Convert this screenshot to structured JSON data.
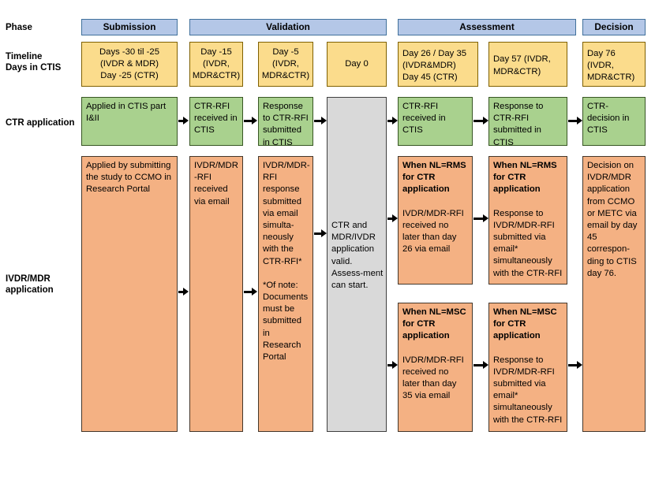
{
  "row_labels": {
    "phase": "Phase",
    "timeline": "Timeline\nDays in CTIS",
    "ctr": "CTR application",
    "ivdr": "IVDR/MDR\napplication"
  },
  "colors": {
    "phase_fill": "#b4c7e7",
    "phase_border": "#41719c",
    "timeline_fill": "#fbdc8c",
    "timeline_border": "#7f6000",
    "ctr_fill": "#a9d18e",
    "ctr_border": "#375623",
    "ivdr_fill": "#f4b183",
    "ivdr_border": "#44372b",
    "neutral_fill": "#d9d9d9",
    "neutral_border": "#3f3f3f",
    "arrow": "#000000",
    "background": "#ffffff"
  },
  "phases": [
    {
      "label": "Submission"
    },
    {
      "label": "Validation"
    },
    {
      "label": "Assessment"
    },
    {
      "label": "Decision"
    }
  ],
  "timeline": [
    {
      "lines": [
        "Days -30 til -25",
        "(IVDR & MDR)",
        "Day -25 (CTR)"
      ]
    },
    {
      "lines": [
        "Day -15",
        "(IVDR,",
        "MDR&CTR)"
      ]
    },
    {
      "lines": [
        "Day -5",
        "(IVDR,",
        "MDR&CTR)"
      ]
    },
    {
      "lines": [
        "Day 0"
      ]
    },
    {
      "lines": [
        "Day 26 / Day 35",
        "(IVDR&MDR)",
        "Day 45 (CTR)"
      ]
    },
    {
      "lines": [
        "Day 57 (IVDR,",
        "MDR&CTR)"
      ]
    },
    {
      "lines": [
        "Day 76",
        "(IVDR,",
        "MDR&CTR)"
      ]
    }
  ],
  "ctr_application": [
    {
      "text": "Applied in CTIS part I&II"
    },
    {
      "text": "CTR-RFI received in CTIS"
    },
    {
      "text": "Response to CTR-RFI submitted in CTIS"
    },
    {
      "text": ""
    },
    {
      "text": "CTR-RFI received in CTIS"
    },
    {
      "text": "Response to CTR-RFI submitted in CTIS"
    },
    {
      "text": "CTR-decision in CTIS"
    }
  ],
  "ivdr_application": {
    "submission": {
      "text": "Applied by submitting the study to CCMO in Research Portal"
    },
    "validation_day15": {
      "text": "IVDR/MDR -RFI received via email"
    },
    "validation_day5": {
      "paragraph1": "IVDR/MDR-RFI response submitted via email simulta-neously with the CTR-RFI*",
      "paragraph2": "*Of note: Documents must be submitted in Research Portal"
    },
    "day0_neutral": {
      "text": "CTR and MDR/IVDR application valid. Assess-ment can start."
    },
    "assessment_rfi_rms": {
      "heading": "When NL=RMS for CTR application",
      "body": "IVDR/MDR-RFI received no later than day 26 via email"
    },
    "assessment_response_rms": {
      "heading": "When NL=RMS for CTR application",
      "body": "Response to IVDR/MDR-RFI submitted via email* simultaneously with the CTR-RFI"
    },
    "assessment_rfi_msc": {
      "heading": "When NL=MSC for CTR application",
      "body": "IVDR/MDR-RFI received no later than day 35 via email"
    },
    "assessment_response_msc": {
      "heading": "When NL=MSC for CTR application",
      "body": "Response to IVDR/MDR-RFI submitted via email* simultaneously with the CTR-RFI"
    },
    "decision": {
      "text": "Decision on IVDR/MDR application from CCMO or METC via email by day 45 correspon-ding to CTIS day 76."
    }
  }
}
